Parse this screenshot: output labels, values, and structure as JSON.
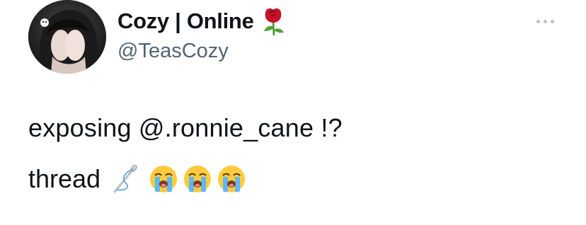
{
  "tweet": {
    "author": {
      "display_name": "Cozy | Online",
      "name_emoji": "rose-icon",
      "handle": "@TeasCozy"
    },
    "text_line_1": "exposing @.ronnie_cane !?",
    "text_line_2": "thread",
    "line_2_icons": [
      "needle-thread-icon",
      "loudly-crying-face-icon",
      "loudly-crying-face-icon",
      "loudly-crying-face-icon"
    ],
    "more_menu_icon": "more-options-icon"
  },
  "colors": {
    "text_primary": "#0f1419",
    "text_secondary": "#536471",
    "more_dots": "#b9c2ca"
  }
}
